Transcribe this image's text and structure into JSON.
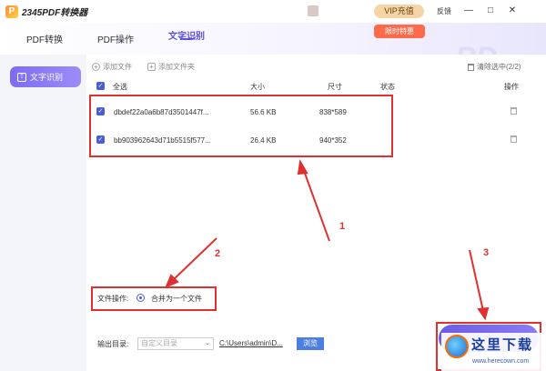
{
  "titlebar": {
    "logo_letter": "P",
    "app_title": "2345PDF转换器",
    "vip_label": "VIP充值",
    "feedback": "反馈",
    "min": "—",
    "max": "□",
    "close": "✕"
  },
  "tabs": [
    {
      "label": "PDF转换"
    },
    {
      "label": "PDF操作"
    },
    {
      "label": "文字识别"
    }
  ],
  "promo": {
    "label": "限时特惠"
  },
  "decor": {
    "brand_text": "PD"
  },
  "sidebar": {
    "items": [
      {
        "label": "文字识别"
      }
    ]
  },
  "toolbar": {
    "add_file": "添加文件",
    "add_folder": "添加文件夹",
    "clear_selected": "清除选中(2/2)"
  },
  "table": {
    "headers": {
      "select_all": "全选",
      "size": "大小",
      "dimension": "尺寸",
      "status": "状态",
      "action": "操作"
    },
    "rows": [
      {
        "name": "dbdef22a0a6b87d3501447f...",
        "size": "56.6 KB",
        "dimension": "838*589",
        "status": ""
      },
      {
        "name": "bb903962643d71b5515f577...",
        "size": "26.4 KB",
        "dimension": "940*352",
        "status": ""
      }
    ]
  },
  "annotations": {
    "n1": "1",
    "n2": "2",
    "n3": "3"
  },
  "file_op": {
    "label": "文件操作:",
    "option": "合并为一个文件"
  },
  "output": {
    "label": "输出目录:",
    "select_value": "自定义目录",
    "path": "C:\\Users\\admin\\D...",
    "browse": "浏览"
  },
  "watermark": {
    "text": "这里下载",
    "url": "www.herecown.com"
  },
  "colors": {
    "accent": "#5b4fe0",
    "annotation_red": "#e03131",
    "checkbox_blue": "#4b5dd6"
  }
}
